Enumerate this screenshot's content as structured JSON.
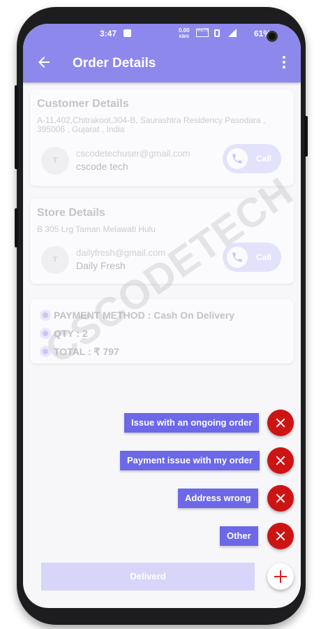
{
  "status_bar": {
    "time": "3:47",
    "net_speed_top": "0.00",
    "net_speed_unit": "KB/S",
    "network": "VoLTE",
    "battery": "61%"
  },
  "app_bar": {
    "title": "Order Details"
  },
  "customer": {
    "heading": "Customer Details",
    "address": "A-11,402,Chitrakoot,304-B, Saurashtra Residency Pasodara , 395006 , Gujarat , India",
    "avatar_initial": "T",
    "email": "cscodetechuser@gmail.com",
    "name": "cscode tech",
    "call_label": "Call"
  },
  "store": {
    "heading": "Store Details",
    "address": "B 305 Lrg Taman Melawati Hulu",
    "avatar_initial": "T",
    "email": "dailyfresh@gmail.com",
    "name": "Daily Fresh",
    "call_label": "Call"
  },
  "order_info": {
    "payment_method": "PAYMENT METHOD : Cash On Delivery",
    "qty": "QTY : 2",
    "total": "TOTAL : ₹ 797"
  },
  "watermark": "CSCODETECH",
  "issue_options": [
    {
      "label": "Issue with an ongoing order"
    },
    {
      "label": "Payment issue with my order"
    },
    {
      "label": "Address wrong"
    },
    {
      "label": "Other"
    }
  ],
  "delivered_button": "Deliverd",
  "colors": {
    "primary": "#8d88eb",
    "option_bg": "#6c68e8",
    "close_red": "#cc1414"
  },
  "icons": {
    "back": "arrow-left-icon",
    "menu": "more-vert-icon",
    "call": "phone-icon",
    "close": "close-icon",
    "fab": "plus-icon"
  }
}
